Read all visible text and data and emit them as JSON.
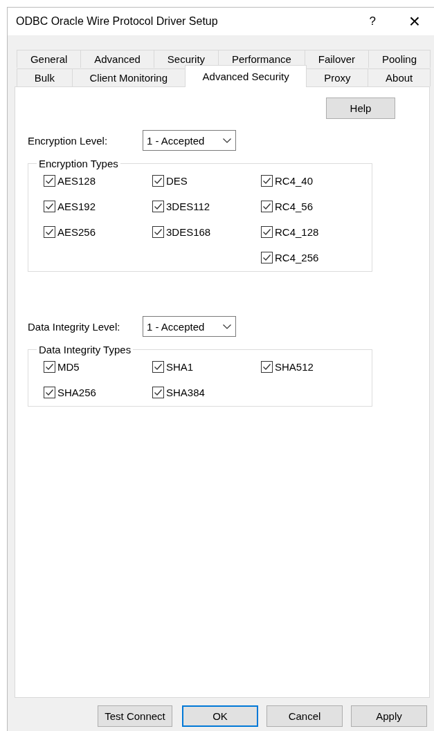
{
  "window": {
    "title": "ODBC Oracle Wire Protocol Driver Setup",
    "help_glyph": "?",
    "close_glyph": "×"
  },
  "tab_rows": [
    [
      {
        "label": "General",
        "selected": false
      },
      {
        "label": "Advanced",
        "selected": false
      },
      {
        "label": "Security",
        "selected": false
      },
      {
        "label": "Performance",
        "selected": false
      },
      {
        "label": "Failover",
        "selected": false
      },
      {
        "label": "Pooling",
        "selected": false
      }
    ],
    [
      {
        "label": "Bulk",
        "selected": false
      },
      {
        "label": "Client Monitoring",
        "selected": false
      },
      {
        "label": "Advanced Security",
        "selected": true
      },
      {
        "label": "Proxy",
        "selected": false
      },
      {
        "label": "About",
        "selected": false
      }
    ]
  ],
  "help_button": "Help",
  "sections": [
    {
      "level_label": "Encryption Level:",
      "level_value": "1 - Accepted",
      "group_title": "Encryption Types",
      "columns": [
        [
          {
            "label": "AES128",
            "checked": true
          },
          {
            "label": "AES192",
            "checked": true
          },
          {
            "label": "AES256",
            "checked": true
          }
        ],
        [
          {
            "label": "DES",
            "checked": true
          },
          {
            "label": "3DES112",
            "checked": true
          },
          {
            "label": "3DES168",
            "checked": true
          }
        ],
        [
          {
            "label": "RC4_40",
            "checked": true
          },
          {
            "label": "RC4_56",
            "checked": true
          },
          {
            "label": "RC4_128",
            "checked": true
          },
          {
            "label": "RC4_256",
            "checked": true
          }
        ]
      ]
    },
    {
      "level_label": "Data Integrity Level:",
      "level_value": "1 - Accepted",
      "group_title": "Data Integrity Types",
      "columns": [
        [
          {
            "label": "MD5",
            "checked": true
          },
          {
            "label": "SHA256",
            "checked": true
          }
        ],
        [
          {
            "label": "SHA1",
            "checked": true
          },
          {
            "label": "SHA384",
            "checked": true
          }
        ],
        [
          {
            "label": "SHA512",
            "checked": true
          }
        ]
      ]
    }
  ],
  "buttons": [
    {
      "label": "Test Connect",
      "default": false
    },
    {
      "label": "OK",
      "default": true
    },
    {
      "label": "Cancel",
      "default": false
    },
    {
      "label": "Apply",
      "default": false
    }
  ]
}
